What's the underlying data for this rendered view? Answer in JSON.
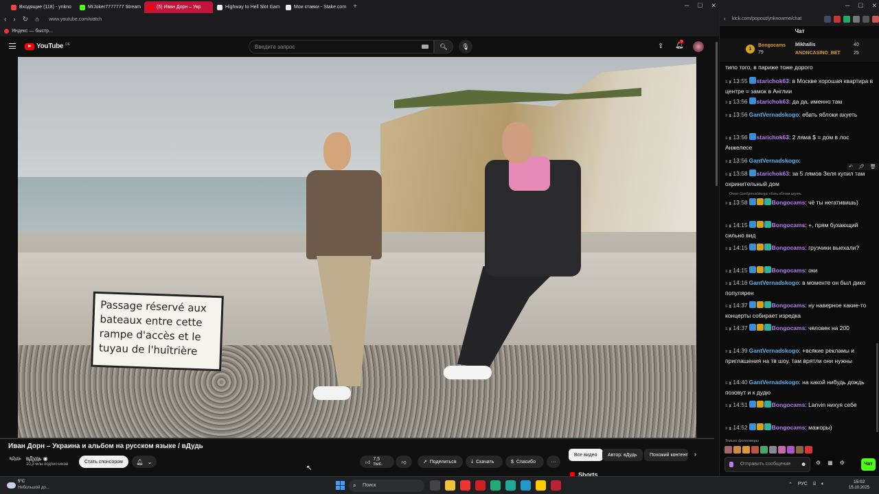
{
  "browser": {
    "tabs": [
      {
        "label": "Входящие (118) - ynkno",
        "color": "#e44"
      },
      {
        "label": "MrJoker7777777 Stream",
        "color": "#53fc18"
      },
      {
        "label": "(5) Иван Дорн – Укр",
        "color": "#f00"
      },
      {
        "label": "Highway to Hell Slot Gam",
        "color": "#eee"
      },
      {
        "label": "Мои ставки - Stake.com",
        "color": "#eee"
      }
    ],
    "active_tab_index": 2,
    "url": "www.youtube.com/watch",
    "bookmark": "Яндекс — быстр..."
  },
  "youtube": {
    "logo_text": "YouTube",
    "logo_country": "DE",
    "search_placeholder": "Введите запрос",
    "notifications_count": "9",
    "video_sign_text": "Passage réservé aux bateaux entre cette rampe d'accès et le tuyau de l'huîtrière",
    "title": "Иван Дорн – Украина и альбом на русском языке / вДудь",
    "channel": {
      "avatar_text": "вДудь",
      "name": "вДудь",
      "subscribers": "10,3 млн подписчиков",
      "sponsor_label": "Стать спонсором"
    },
    "actions": {
      "likes": "7,5 тыс.",
      "share": "Поделиться",
      "download": "Скачать",
      "thanks": "Спасибо"
    },
    "chips": [
      "Все видео",
      "Автор: вДудь",
      "Похожий контент"
    ],
    "shorts_label": "Shorts"
  },
  "chat": {
    "url": "kick.com/popout/ynknowme/chat",
    "title": "Чат",
    "leaderboard": {
      "rank": "1",
      "first": {
        "name": "Bongocams",
        "value": "79"
      },
      "second": {
        "name": "Mikhailis",
        "value": "40"
      },
      "third": {
        "name": "ANONCASINO_BET",
        "value": "25"
      }
    },
    "messages": [
      {
        "time": "",
        "user": "",
        "text": "типо того, в париже тоже дорого",
        "badges": [],
        "ucolor": "u-blue"
      },
      {
        "time": "13:55",
        "user": "starichok63",
        "text": "в Москве хорошая квартира в центре = замок в Англии",
        "badges": [
          "b-blue"
        ],
        "ucolor": "u-purple"
      },
      {
        "time": "13:56",
        "user": "starichok63",
        "text": "да да, именно там",
        "badges": [
          "b-blue"
        ],
        "ucolor": "u-purple"
      },
      {
        "time": "13:56",
        "user": "GantVernadskogo",
        "text": "ебать яблоки ахуеть",
        "badges": [],
        "ucolor": "u-blue"
      },
      {
        "time": "13:56",
        "user": "starichok63",
        "text": "2 ляма $ = дом в лос Анжелесе",
        "badges": [
          "b-blue"
        ],
        "ucolor": "u-purple"
      },
      {
        "time": "13:56",
        "user": "GantVernadskogo",
        "text": "",
        "badges": [],
        "ucolor": "u-blue"
      },
      {
        "time": "13:58",
        "user": "starichok63",
        "text": "за 5 лямов Зеля купил там охринительный дом",
        "badges": [
          "b-blue"
        ],
        "ucolor": "u-purple"
      },
      {
        "time": "13:58",
        "user": "Bongocams",
        "text": "чё ты негативишь)",
        "badges": [
          "b-blue",
          "b-gold",
          "b-teal"
        ],
        "ucolor": "u-purple"
      },
      {
        "time": "14:15",
        "user": "Bongocams",
        "text": "+, прям бухающий сильно вид",
        "badges": [
          "b-blue",
          "b-gold",
          "b-teal"
        ],
        "ucolor": "u-purple"
      },
      {
        "time": "14:15",
        "user": "Bongocams",
        "text": "грузчики выехали?",
        "badges": [
          "b-blue",
          "b-gold",
          "b-teal"
        ],
        "ucolor": "u-purple"
      },
      {
        "time": "14:15",
        "user": "Bongocams",
        "text": "оки",
        "badges": [
          "b-blue",
          "b-gold",
          "b-teal"
        ],
        "ucolor": "u-purple"
      },
      {
        "time": "14:16",
        "user": "GantVernadskogo",
        "text": "в моменте он был дико популярен",
        "badges": [],
        "ucolor": "u-blue"
      },
      {
        "time": "14:37",
        "user": "Bongocams",
        "text": "ну наверное какие-то концерты собирает изредка",
        "badges": [
          "b-blue",
          "b-gold",
          "b-teal"
        ],
        "ucolor": "u-purple"
      },
      {
        "time": "14:37",
        "user": "Bongocams",
        "text": "человек на 200",
        "badges": [
          "b-blue",
          "b-gold",
          "b-teal"
        ],
        "ucolor": "u-purple"
      },
      {
        "time": "14:39",
        "user": "GantVernadskogo",
        "text": "+всякие рекламы и приглашения на тв шоу. там врятли они нужны",
        "badges": [],
        "ucolor": "u-blue"
      },
      {
        "time": "14:40",
        "user": "GantVernadskogo",
        "text": "на какой нибудь дождь позовут и к дудю",
        "badges": [],
        "ucolor": "u-blue"
      },
      {
        "time": "14:51",
        "user": "Bongocams",
        "text": "Lanvin нихуя себе",
        "badges": [
          "b-blue",
          "b-gold",
          "b-teal"
        ],
        "ucolor": "u-purple"
      },
      {
        "time": "14:52",
        "user": "Bongocams",
        "text": "мажоры)",
        "badges": [
          "b-blue",
          "b-gold",
          "b-teal"
        ],
        "ucolor": "u-purple"
      }
    ],
    "reply_note": "Ответ GantVernadskogo: ебать яблоки ахуеть",
    "followers_only": "Только фолловеры",
    "input_placeholder": "Отправить сообщение",
    "send_label": "Чат"
  },
  "taskbar": {
    "weather_temp": "5°C",
    "weather_desc": "Небольшой до...",
    "search_label": "Поиск",
    "lang": "РУС",
    "time": "15:02",
    "date": "15.10.2025"
  }
}
